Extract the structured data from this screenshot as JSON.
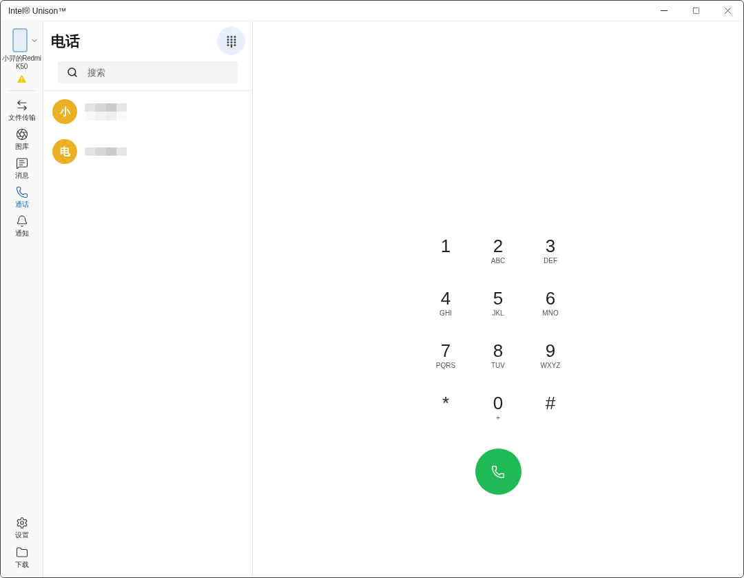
{
  "window": {
    "title": "Intel® Unison™"
  },
  "device": {
    "name": "小羿的Redmi K50",
    "warning": true
  },
  "sidebar": {
    "items": [
      {
        "kind": "transfer",
        "label": "文件传输",
        "selected": false
      },
      {
        "kind": "gallery",
        "label": "图库",
        "selected": false
      },
      {
        "kind": "messages",
        "label": "消息",
        "selected": false
      },
      {
        "kind": "calls",
        "label": "通话",
        "selected": true
      },
      {
        "kind": "notifications",
        "label": "通知",
        "selected": false
      }
    ],
    "bottom_items": [
      {
        "kind": "settings",
        "label": "设置"
      },
      {
        "kind": "downloads",
        "label": "下载"
      }
    ]
  },
  "contacts_panel": {
    "title": "电话",
    "search": {
      "placeholder": "搜索"
    },
    "contacts": [
      {
        "initial": "小",
        "color": "#e9b023",
        "two_lines": true
      },
      {
        "initial": "电",
        "color": "#e9b023",
        "two_lines": false
      }
    ]
  },
  "dialpad": {
    "keys": [
      {
        "digit": "1"
      },
      {
        "digit": "2",
        "letters": "ABC"
      },
      {
        "digit": "3",
        "letters": "DEF"
      },
      {
        "digit": "4",
        "letters": "GHI"
      },
      {
        "digit": "5",
        "letters": "JKL"
      },
      {
        "digit": "6",
        "letters": "MNO"
      },
      {
        "digit": "7",
        "letters": "PQRS"
      },
      {
        "digit": "8",
        "letters": "TUV"
      },
      {
        "digit": "9",
        "letters": "WXYZ"
      },
      {
        "digit": "*"
      },
      {
        "digit": "0",
        "letters": "+"
      },
      {
        "digit": "#"
      }
    ]
  }
}
